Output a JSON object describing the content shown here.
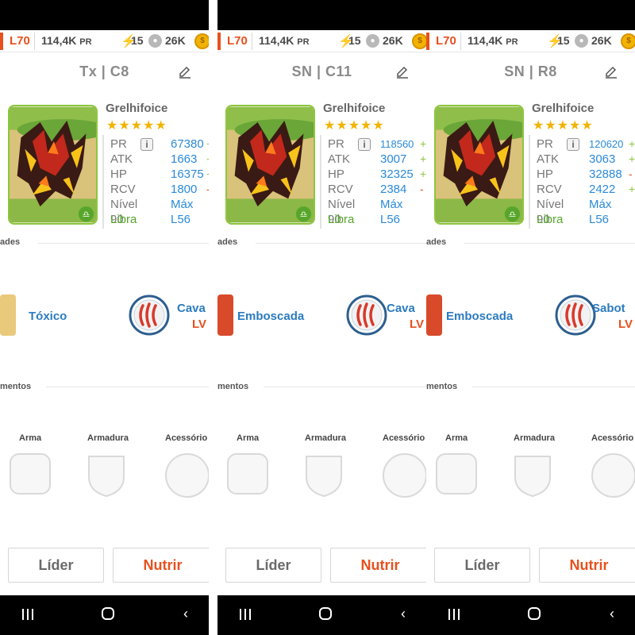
{
  "colors": {
    "accent": "#e8501d",
    "link_blue": "#2b8ad8",
    "star_gold": "#f2b300",
    "positive_green": "#8cc63f"
  },
  "status": {
    "level": "L70",
    "power": "114,4K",
    "power_unit": "PR",
    "energy": "15",
    "paw_points": "26K"
  },
  "labels": {
    "pr": "PR",
    "atk": "ATK",
    "hp": "HP",
    "rcv": "RCV",
    "level": "Nível 90",
    "level_value": "Máx",
    "element": "Libra",
    "element_value": "L56",
    "dragon_name": "Grelhifoice",
    "skills_section": "ades",
    "equip_section": "mentos",
    "weapon": "Arma",
    "armor": "Armadura",
    "accessory": "Acessório",
    "leader_button": "Líder",
    "feed_button": "Nutrir",
    "skill_level": "LV"
  },
  "panels": [
    {
      "team_title": "Tx | C8",
      "pr_value": "67380",
      "pr_delta": "+",
      "atk_value": "1663",
      "atk_delta": "+",
      "hp_value": "16375",
      "hp_delta": "+",
      "rcv_value": "1800",
      "rcv_delta": "-",
      "skill1_name": "Tóxico",
      "skill2_name": "Cava"
    },
    {
      "team_title": "SN | C11",
      "pr_value": "118560",
      "pr_delta": "+",
      "atk_value": "3007",
      "atk_delta": "+",
      "hp_value": "32325",
      "hp_delta": "+",
      "rcv_value": "2384",
      "rcv_delta": "-",
      "skill1_name": "Emboscada",
      "skill2_name": "Cava"
    },
    {
      "team_title": "SN | R8",
      "pr_value": "120620",
      "pr_delta": "+",
      "atk_value": "3063",
      "atk_delta": "+",
      "hp_value": "32888",
      "hp_delta": "-",
      "rcv_value": "2422",
      "rcv_delta": "+",
      "skill1_name": "Emboscada",
      "skill2_name": "Sabot"
    }
  ],
  "icons": {
    "energy": "lightning-bolt-icon",
    "paw": "paw-icon",
    "coin": "gold-coin-icon",
    "edit": "pencil-icon",
    "info": "info-icon",
    "zodiac": "libra-icon",
    "claw": "claw-skill-icon",
    "nav_recent": "recent-apps-icon",
    "nav_home": "home-icon",
    "nav_back": "back-icon"
  }
}
